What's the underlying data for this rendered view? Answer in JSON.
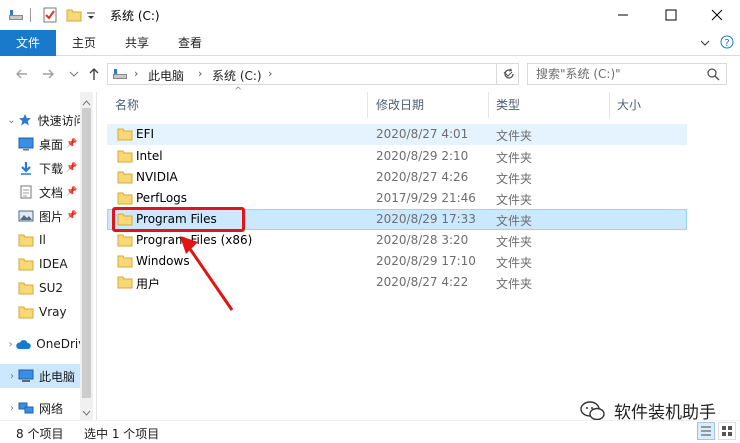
{
  "window": {
    "title": "系统 (C:)",
    "minimize_icon": "minimize-icon",
    "maximize_icon": "maximize-icon",
    "close_icon": "close-icon"
  },
  "quick_access_toolbar": {
    "icons": [
      "drive-icon",
      "properties-check-icon",
      "new-folder-icon",
      "dropdown-chevron-icon"
    ]
  },
  "ribbon": {
    "tabs": [
      "文件",
      "主页",
      "共享",
      "查看"
    ],
    "active_tab": "文件",
    "accent_color": "#1979ca"
  },
  "address_bar": {
    "segments": [
      "此电脑",
      "系统 (C:)"
    ],
    "search_placeholder": "搜索\"系统 (C:)\""
  },
  "nav_pane": {
    "items": [
      {
        "label": "快速访问",
        "icon": "star-icon",
        "pinned": false,
        "expandable": true
      },
      {
        "label": "桌面",
        "icon": "desktop-icon",
        "pinned": true
      },
      {
        "label": "下载",
        "icon": "download-arrow-icon",
        "pinned": true
      },
      {
        "label": "文档",
        "icon": "document-icon",
        "pinned": true
      },
      {
        "label": "图片",
        "icon": "picture-icon",
        "pinned": true
      },
      {
        "label": "Il",
        "icon": "folder-icon",
        "pinned": false
      },
      {
        "label": "IDEA",
        "icon": "folder-icon",
        "pinned": false
      },
      {
        "label": "SU2",
        "icon": "folder-icon",
        "pinned": false
      },
      {
        "label": "Vray",
        "icon": "folder-icon",
        "pinned": false
      },
      {
        "label": "OneDrive",
        "icon": "cloud-icon",
        "pinned": false,
        "expandable": true
      },
      {
        "label": "此电脑",
        "icon": "computer-icon",
        "pinned": false,
        "expandable": true,
        "selected": true
      },
      {
        "label": "网络",
        "icon": "network-icon",
        "pinned": false,
        "expandable": true
      }
    ]
  },
  "columns": {
    "name": "名称",
    "date": "修改日期",
    "type": "类型",
    "size": "大小"
  },
  "files": [
    {
      "name": "EFI",
      "date": "2020/8/27 4:01",
      "type": "文件夹"
    },
    {
      "name": "Intel",
      "date": "2020/8/29 2:10",
      "type": "文件夹"
    },
    {
      "name": "NVIDIA",
      "date": "2020/8/27 4:26",
      "type": "文件夹"
    },
    {
      "name": "PerfLogs",
      "date": "2017/9/29 21:46",
      "type": "文件夹"
    },
    {
      "name": "Program Files",
      "date": "2020/8/29 17:33",
      "type": "文件夹"
    },
    {
      "name": "Program Files (x86)",
      "date": "2020/8/28 3:20",
      "type": "文件夹"
    },
    {
      "name": "Windows",
      "date": "2020/8/29 17:10",
      "type": "文件夹"
    },
    {
      "name": "用户",
      "date": "2020/8/27 4:22",
      "type": "文件夹"
    }
  ],
  "selection": {
    "hover_row": "EFI",
    "selected_row": "Program Files",
    "annotation_color": "#e21414"
  },
  "status": {
    "item_count": "8 个项目",
    "selected_count": "选中 1 个项目"
  },
  "watermark": {
    "text": "软件装机助手",
    "icon": "wechat-icon"
  }
}
